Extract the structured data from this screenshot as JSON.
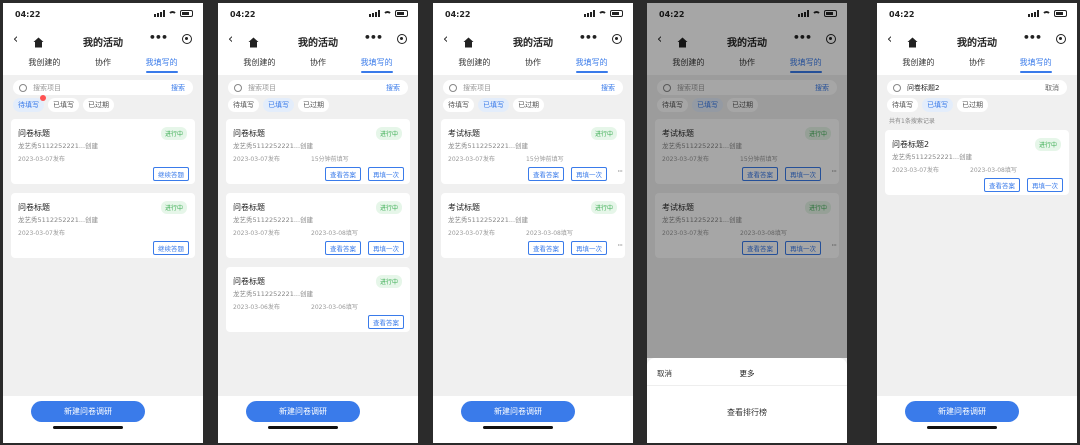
{
  "phones": [
    {
      "time": "04:22",
      "title": "我的活动",
      "tabs": [
        "我创建的",
        "协作",
        "我填写的"
      ],
      "active_tab": 2,
      "search": {
        "placeholder": "搜索项目",
        "action": "搜索"
      },
      "filters": [
        "待填写",
        "已填写",
        "已过期"
      ],
      "active_filter": 0,
      "cards": [
        {
          "title": "问卷标题",
          "status": "进行中",
          "creator": "龙艺秀5112252221...创建",
          "meta1": "2023-03-07发布",
          "meta2": "",
          "buttons": [
            "继续答题"
          ]
        },
        {
          "title": "问卷标题",
          "status": "进行中",
          "creator": "龙艺秀5112252221...创建",
          "meta1": "2023-03-07发布",
          "meta2": "",
          "buttons": [
            "继续答题"
          ]
        }
      ],
      "create_button": "新建问卷调研"
    },
    {
      "time": "04:22",
      "title": "我的活动",
      "tabs": [
        "我创建的",
        "协作",
        "我填写的"
      ],
      "active_tab": 2,
      "search": {
        "placeholder": "搜索项目",
        "action": "搜索"
      },
      "filters": [
        "待填写",
        "已填写",
        "已过期"
      ],
      "active_filter": 1,
      "cards": [
        {
          "title": "问卷标题",
          "status": "进行中",
          "creator": "龙艺秀5112252221...创建",
          "meta1": "2023-03-07发布",
          "meta2": "15分钟前填写",
          "buttons": [
            "查看答案",
            "再填一次"
          ]
        },
        {
          "title": "问卷标题",
          "status": "进行中",
          "creator": "龙艺秀5112252221...创建",
          "meta1": "2023-03-07发布",
          "meta2": "2023-03-08填写",
          "buttons": [
            "查看答案",
            "再填一次"
          ]
        },
        {
          "title": "问卷标题",
          "status": "进行中",
          "creator": "龙艺秀5112252221...创建",
          "meta1": "2023-03-06发布",
          "meta2": "2023-03-06填写",
          "buttons": [
            "查看答案"
          ]
        }
      ],
      "create_button": "新建问卷调研"
    },
    {
      "time": "04:22",
      "title": "我的活动",
      "tabs": [
        "我创建的",
        "协作",
        "我填写的"
      ],
      "active_tab": 2,
      "search": {
        "placeholder": "搜索项目",
        "action": "搜索"
      },
      "filters": [
        "待填写",
        "已填写",
        "已过期"
      ],
      "active_filter": 1,
      "cards": [
        {
          "title": "考试标题",
          "status": "进行中",
          "creator": "龙艺秀5112252221...创建",
          "meta1": "2023-03-07发布",
          "meta2": "15分钟前填写",
          "buttons": [
            "查看答案",
            "再填一次"
          ],
          "more": "···"
        },
        {
          "title": "考试标题",
          "status": "进行中",
          "creator": "龙艺秀5112252221...创建",
          "meta1": "2023-03-07发布",
          "meta2": "2023-03-08填写",
          "buttons": [
            "查看答案",
            "再填一次"
          ],
          "more": "···"
        }
      ],
      "create_button": "新建问卷调研"
    },
    {
      "time": "04:22",
      "title": "我的活动",
      "tabs": [
        "我创建的",
        "协作",
        "我填写的"
      ],
      "active_tab": 2,
      "search": {
        "placeholder": "搜索项目",
        "action": "搜索"
      },
      "filters": [
        "待填写",
        "已填写",
        "已过期"
      ],
      "active_filter": 1,
      "cards": [
        {
          "title": "考试标题",
          "status": "进行中",
          "creator": "龙艺秀5112252221...创建",
          "meta1": "2023-03-07发布",
          "meta2": "15分钟前填写",
          "buttons": [
            "查看答案",
            "再填一次"
          ],
          "more": "···"
        },
        {
          "title": "考试标题",
          "status": "进行中",
          "creator": "龙艺秀5112252221...创建",
          "meta1": "2023-03-07发布",
          "meta2": "2023-03-08填写",
          "buttons": [
            "查看答案",
            "再填一次"
          ],
          "more": "···"
        }
      ],
      "sheet": {
        "cancel": "取消",
        "title": "更多",
        "option": "查看排行榜"
      }
    },
    {
      "time": "04:22",
      "title": "我的活动",
      "tabs": [
        "我创建的",
        "协作",
        "我填写的"
      ],
      "active_tab": 2,
      "search": {
        "value": "问卷标题2",
        "action": "取消"
      },
      "filters": [
        "待填写",
        "已填写",
        "已过期"
      ],
      "active_filter": 1,
      "note": "共有1条搜索记录",
      "cards": [
        {
          "title": "问卷标题2",
          "status": "进行中",
          "creator": "龙艺秀5112252221...创建",
          "meta1": "2023-03-07发布",
          "meta2": "2023-03-08填写",
          "buttons": [
            "查看答案",
            "再填一次"
          ]
        }
      ],
      "create_button": "新建问卷调研"
    }
  ],
  "colors": {
    "accent": "#3a7bea",
    "status_green": "#3dae55",
    "badge_dot": "#ff5252",
    "canvas": "#2b2b2b"
  }
}
